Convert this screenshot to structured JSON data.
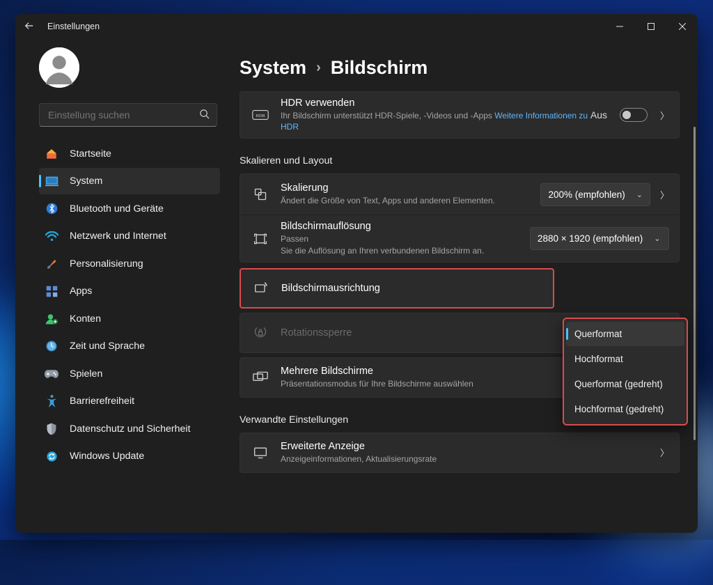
{
  "window": {
    "title": "Einstellungen"
  },
  "search": {
    "placeholder": "Einstellung suchen"
  },
  "sidebar": {
    "items": [
      {
        "label": "Startseite"
      },
      {
        "label": "System"
      },
      {
        "label": "Bluetooth und Geräte"
      },
      {
        "label": "Netzwerk und Internet"
      },
      {
        "label": "Personalisierung"
      },
      {
        "label": "Apps"
      },
      {
        "label": "Konten"
      },
      {
        "label": "Zeit und Sprache"
      },
      {
        "label": "Spielen"
      },
      {
        "label": "Barrierefreiheit"
      },
      {
        "label": "Datenschutz und Sicherheit"
      },
      {
        "label": "Windows Update"
      }
    ]
  },
  "crumb": {
    "root": "System",
    "leaf": "Bildschirm"
  },
  "hdr": {
    "title": "HDR verwenden",
    "sub_prefix": "Ihr Bildschirm unterstützt HDR-Spiele, -Videos und -Apps  ",
    "link": "Weitere Informationen zu HDR",
    "toggle_label": "Aus"
  },
  "sections": {
    "scale_layout": "Skalieren und Layout",
    "related": "Verwandte Einstellungen"
  },
  "scaling": {
    "title": "Skalierung",
    "sub": "Ändert die Größe von Text, Apps und anderen Elementen.",
    "value": "200% (empfohlen)"
  },
  "resolution": {
    "title": "Bildschirmauflösung",
    "sub_line1": "Passen",
    "sub_line2": "Sie die Auflösung an Ihren verbundenen Bildschirm an.",
    "value": "2880 × 1920 (empfohlen)"
  },
  "orientation": {
    "title": "Bildschirmausrichtung",
    "options": [
      "Querformat",
      "Hochformat",
      "Querformat (gedreht)",
      "Hochformat (gedreht)"
    ]
  },
  "rotation_lock": {
    "title": "Rotationssperre"
  },
  "multiple": {
    "title": "Mehrere Bildschirme",
    "sub": "Präsentationsmodus für Ihre Bildschirme auswählen"
  },
  "advanced": {
    "title": "Erweiterte Anzeige",
    "sub": "Anzeigeinformationen, Aktualisierungsrate"
  }
}
